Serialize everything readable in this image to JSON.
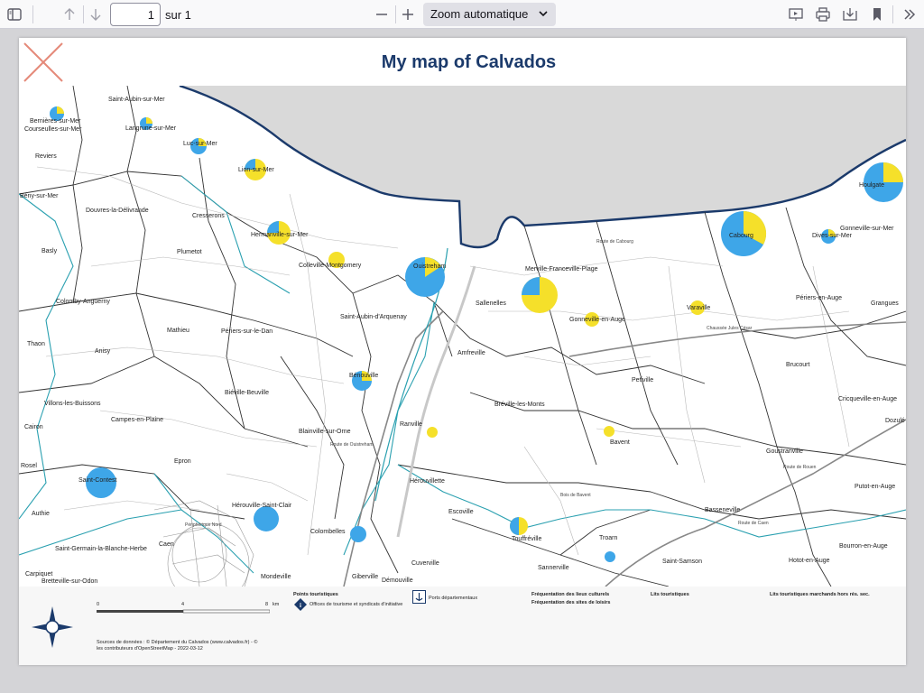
{
  "toolbar": {
    "page_number": "1",
    "page_of": "sur 1",
    "zoom": "Zoom automatique",
    "icons": [
      "sidebar-toggle-icon",
      "arrow-up-icon",
      "arrow-down-icon",
      "zoom-out-icon",
      "zoom-in-icon",
      "presentation-icon",
      "print-icon",
      "save-icon",
      "bookmark-icon",
      "more-tools-icon"
    ]
  },
  "map": {
    "title": "My map of Calvados",
    "colors": {
      "tourism_office": "#3ea6e8",
      "leisure": "#f5e02a",
      "coast": "#1b3a6b",
      "sea": "#d9d9d9",
      "commune_border": "#333333",
      "canton_border": "#2aa0b0"
    },
    "places": [
      "Saint-Aubin-sur-Mer",
      "Bernières-sur-Mer",
      "Courseulles-sur-Mer",
      "Langrune-sur-Mer",
      "Luc-sur-Mer",
      "Lion-sur-Mer",
      "Reviers",
      "Bény-sur-Mer",
      "Douvres-la-Délivrande",
      "Cresserons",
      "Hermanville-sur-Mer",
      "Colleville-Montgomery",
      "Ouistreham",
      "Merville-Franceville-Plage",
      "Cabourg",
      "Houlgate",
      "Gonneville-sur-Mer",
      "Dives-sur-Mer",
      "Basly",
      "Plumetot",
      "Colomby-Anguerny",
      "Mathieu",
      "Périers-sur-le-Dan",
      "Saint-Aubin-d'Arquenay",
      "Sallenelles",
      "Gonneville-en-Auge",
      "Varaville",
      "Périers-en-Auge",
      "Grangues",
      "Thaon",
      "Anisy",
      "Amfreville",
      "Petiville",
      "Brucourt",
      "Cricqueville-en-Auge",
      "Biéville-Beuville",
      "Bénouville",
      "Villons-les-Buissons",
      "Bréville-les-Monts",
      "Cairon",
      "Campes-en-Plaine",
      "Blainville-sur-Orne",
      "Ranville",
      "Bavent",
      "Dozulé",
      "Rosel",
      "Epron",
      "Saint-Contest",
      "Hérouvillette",
      "Goustranville",
      "Putot-en-Auge",
      "Authie",
      "Hérouville-Saint-Clair",
      "Escoville",
      "Basseneville",
      "Saint-Germain-la-Blanche-Herbe",
      "Caen",
      "Colombelles",
      "Touffréville",
      "Troarn",
      "Bourron-en-Auge",
      "Saint-Samson",
      "Hotot-en-Auge",
      "Carpiquet",
      "Bretteville-sur-Odon",
      "Mondeville",
      "Giberville",
      "Démouville",
      "Cuverville",
      "Sannerville"
    ],
    "roads": [
      "Chaussée Jules César",
      "Route de Rouen",
      "Route de Caen",
      "Route de Cabourg",
      "Périphérique Nord",
      "Route de Ouistreham",
      "Bois de Bavent"
    ]
  },
  "legend": {
    "scale_ticks": [
      "0",
      "4",
      "8"
    ],
    "scale_unit": "km",
    "points_title": "Points touristiques",
    "office_label": "Offices de tourisme et syndicats d'initiative",
    "ports_label": "Ports départementaux",
    "culture_label": "Fréquentation des lieux culturels",
    "leisure_label": "Fréquentation des sites de loisirs",
    "beds_label": "Lits touristiques",
    "beds_market_label": "Lits touristiques marchands hors rés. sec.",
    "source_line1": "Sources de données : © Département du Calvados (www.calvados.fr) - ©",
    "source_line2": "les contributeurs d'OpenStreetMap - 2022-03-12"
  }
}
